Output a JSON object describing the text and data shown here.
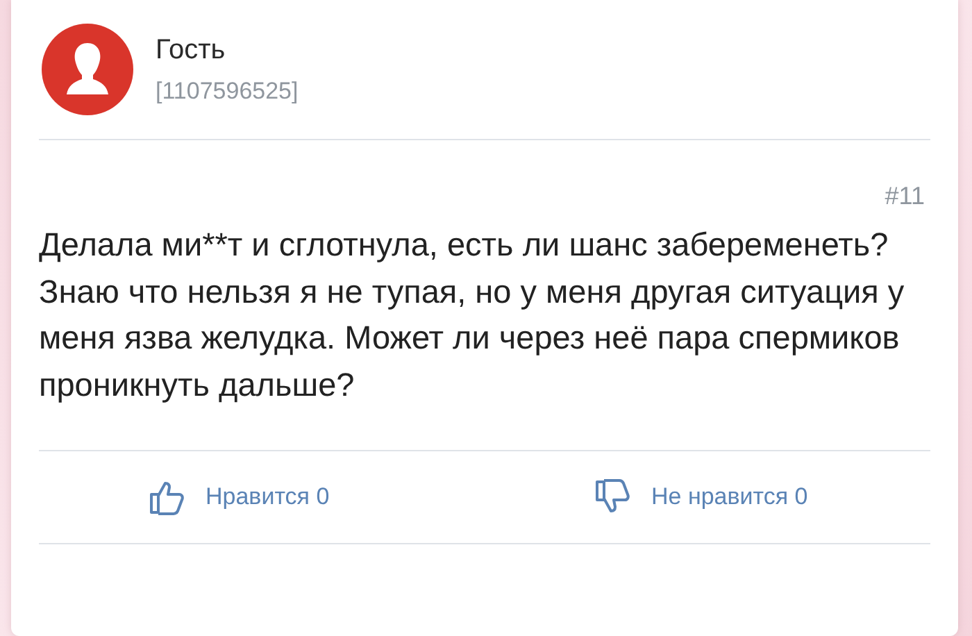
{
  "author": {
    "name": "Гость",
    "id": "[1107596525]"
  },
  "post": {
    "number": "#11",
    "text": "Делала ми**т и сглотнула, есть ли шанс забеременеть? Знаю что нельзя я не тупая, но у меня другая ситуация у меня язва желудка. Может ли через неё пара спермиков проникнуть дальше?"
  },
  "reactions": [
    {
      "kind": "like",
      "label": "Нравится 0"
    },
    {
      "kind": "dislike",
      "label": "Не нравится 0"
    }
  ]
}
